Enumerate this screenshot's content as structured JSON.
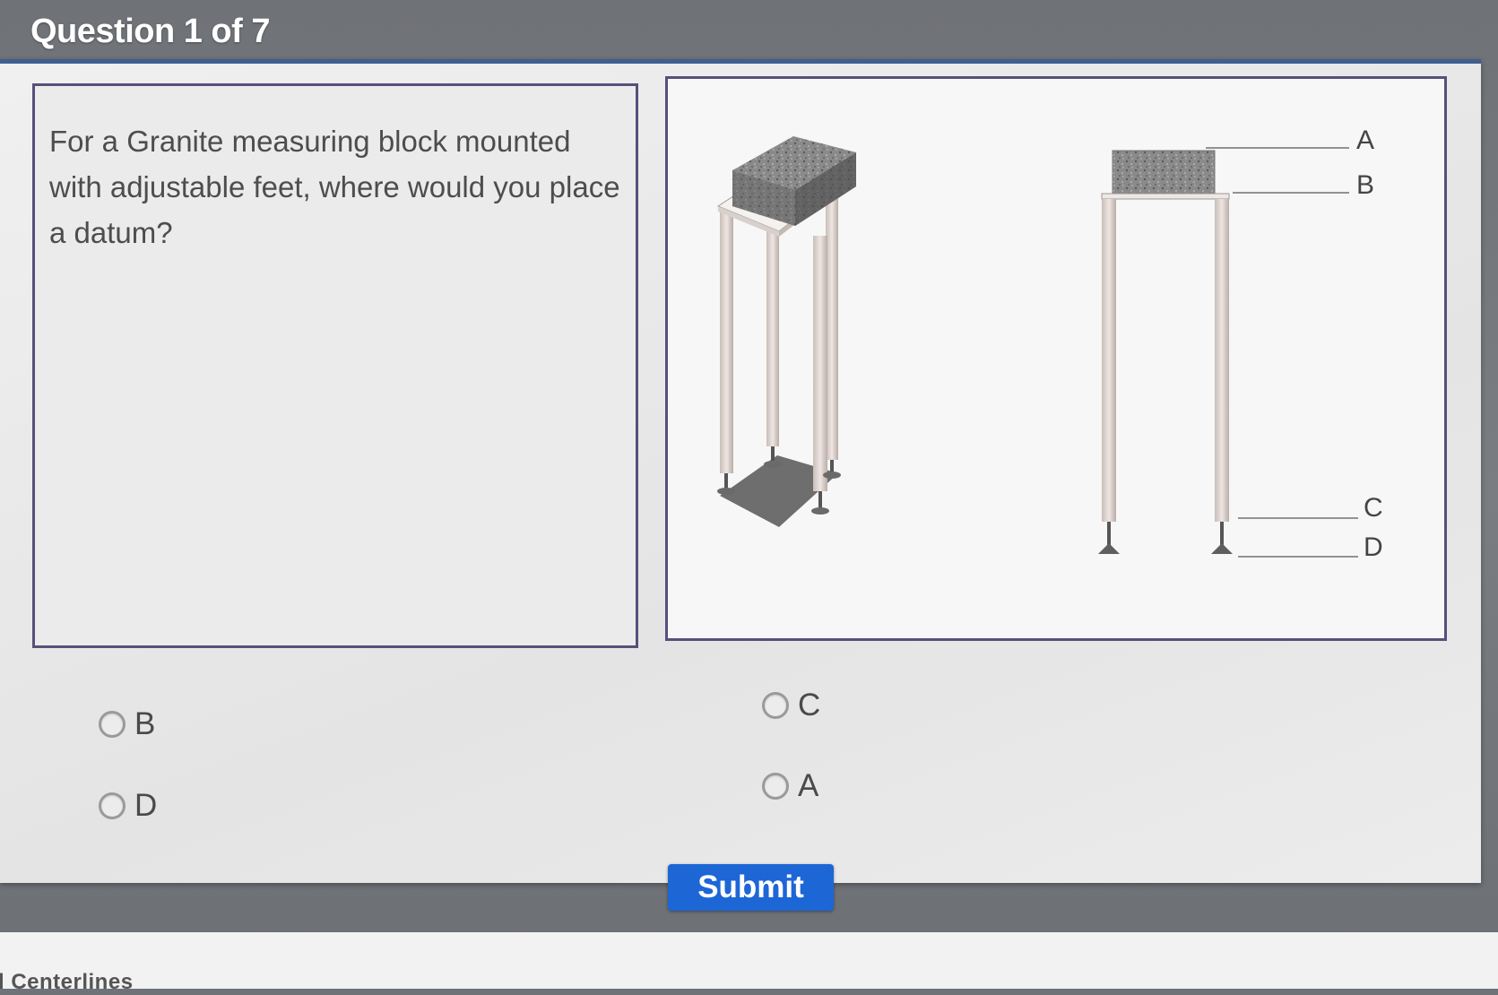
{
  "header": {
    "title": "Question 1 of 7"
  },
  "question": {
    "text": "For a Granite measuring block mounted with adjustable feet, where would you place a datum?"
  },
  "figure": {
    "labels": {
      "a": "A",
      "b": "B",
      "c": "C",
      "d": "D"
    }
  },
  "options": [
    {
      "label": "B",
      "selected": false
    },
    {
      "label": "D",
      "selected": false
    },
    {
      "label": "C",
      "selected": false
    },
    {
      "label": "A",
      "selected": false
    }
  ],
  "submit": {
    "label": "Submit"
  },
  "footer": {
    "partial_text": "d Centerlines"
  },
  "colors": {
    "accent": "#1d66d6",
    "border": "#56507a",
    "header_rule": "#3f5f8f"
  }
}
